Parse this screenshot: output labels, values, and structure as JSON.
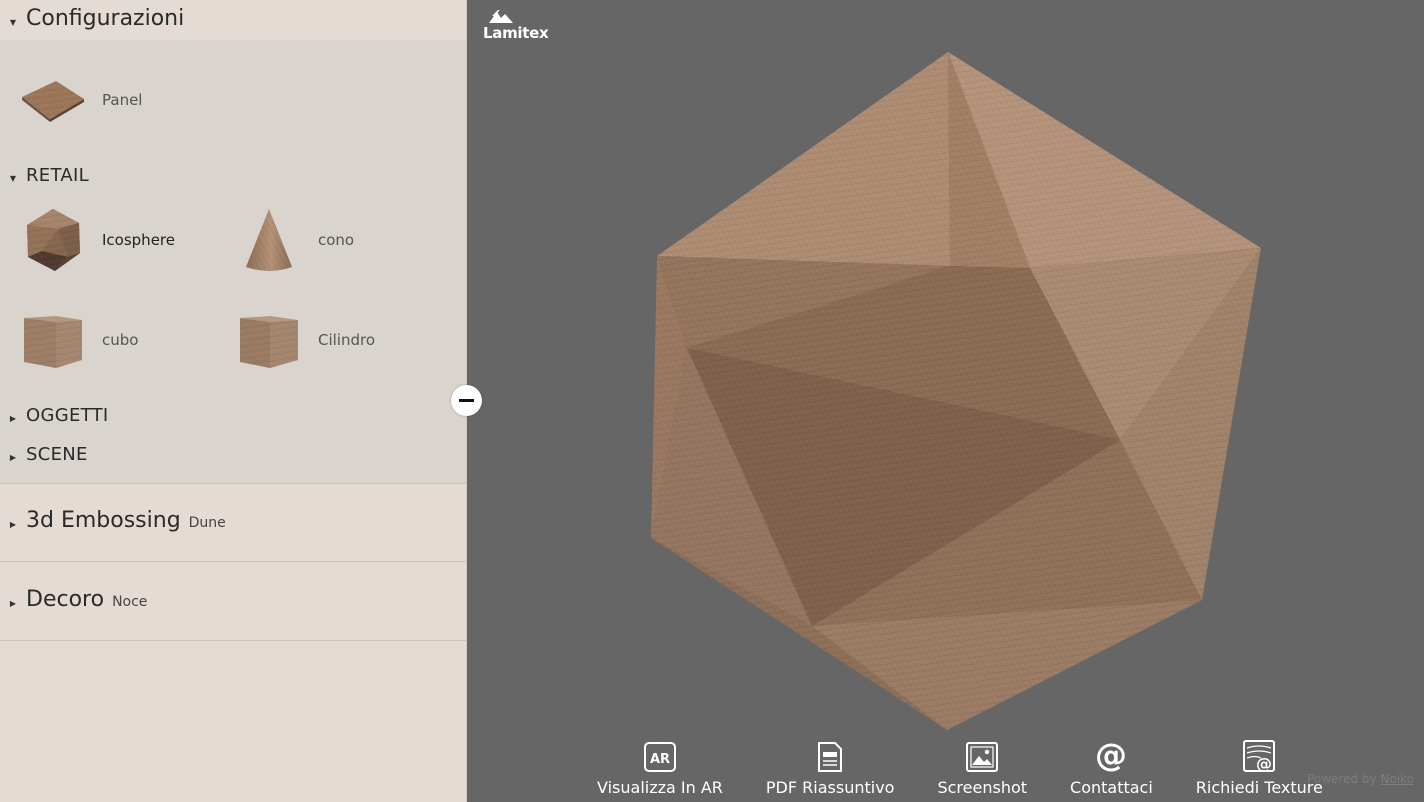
{
  "sidebar": {
    "configurazioni": {
      "title": "Configurazioni",
      "top_items": [
        {
          "label": "Panel",
          "icon": "wood-panel-thumbnail"
        }
      ],
      "groups": [
        {
          "title": "RETAIL",
          "expanded": true,
          "items": [
            {
              "label": "Icosphere",
              "icon": "icosphere-thumbnail",
              "selected": true
            },
            {
              "label": "cono",
              "icon": "cone-thumbnail"
            },
            {
              "label": "cubo",
              "icon": "cube-thumbnail"
            },
            {
              "label": "Cilindro",
              "icon": "cylinder-thumbnail"
            }
          ]
        },
        {
          "title": "OGGETTI",
          "expanded": false
        },
        {
          "title": "SCENE",
          "expanded": false
        }
      ]
    },
    "embossing": {
      "title": "3d Embossing",
      "value": "Dune"
    },
    "decoro": {
      "title": "Decoro",
      "value": "Noce"
    }
  },
  "viewport": {
    "brand": "Lamitex",
    "toolbar": [
      {
        "label": "Visualizza In AR",
        "icon": "ar-icon"
      },
      {
        "label": "PDF Riassuntivo",
        "icon": "document-icon"
      },
      {
        "label": "Screenshot",
        "icon": "image-icon"
      },
      {
        "label": "Contattaci",
        "icon": "at-icon"
      },
      {
        "label": "Richiedi Texture",
        "icon": "texture-request-icon"
      }
    ],
    "powered_by": {
      "text": "Powered by",
      "link": "Noiko"
    }
  },
  "colors": {
    "sidebar_bg": "#e3dbd4",
    "panel_bg": "#d9d4cd",
    "viewport_bg": "#666666",
    "wood_light": "#b8977c",
    "wood_dark": "#6e5444"
  }
}
